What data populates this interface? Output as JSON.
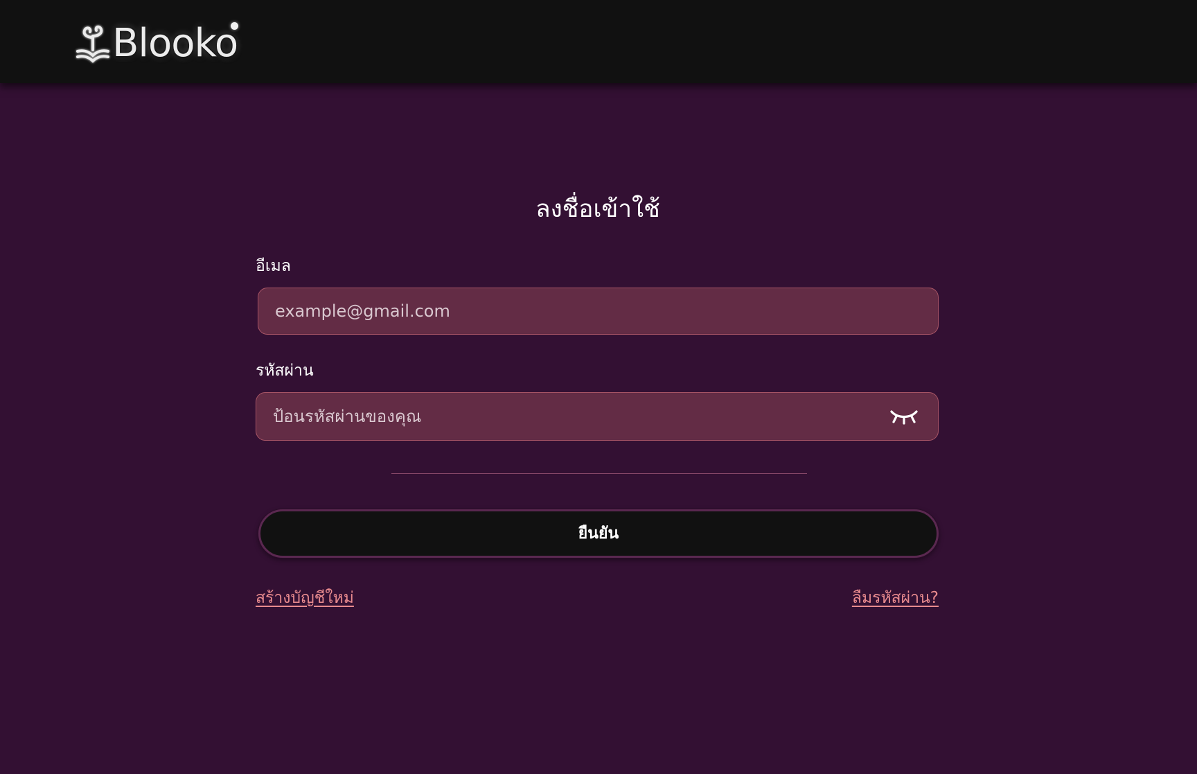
{
  "header": {
    "logo_text": "Blooko",
    "logo_icon": "book-sprout-logo-icon"
  },
  "login_form": {
    "title": "ลงชื่อเข้าใช้",
    "email": {
      "label": "อีเมล",
      "value": "",
      "placeholder": "example@gmail.com"
    },
    "password": {
      "label": "รหัสผ่าน",
      "value": "",
      "placeholder": "ป้อนรหัสผ่านของคุณ",
      "toggle_icon": "eye-closed-icon"
    },
    "submit_label": "ยืนยัน",
    "create_account_link": "สร้างบัญชีใหม่",
    "forgot_password_link": "ลืมรหัสผ่าน?"
  },
  "colors": {
    "page_background": "#331033",
    "header_background": "#111111",
    "input_background": "#632c45",
    "input_border": "#a85566",
    "button_background": "#111111",
    "link_color": "#e88a8e"
  }
}
